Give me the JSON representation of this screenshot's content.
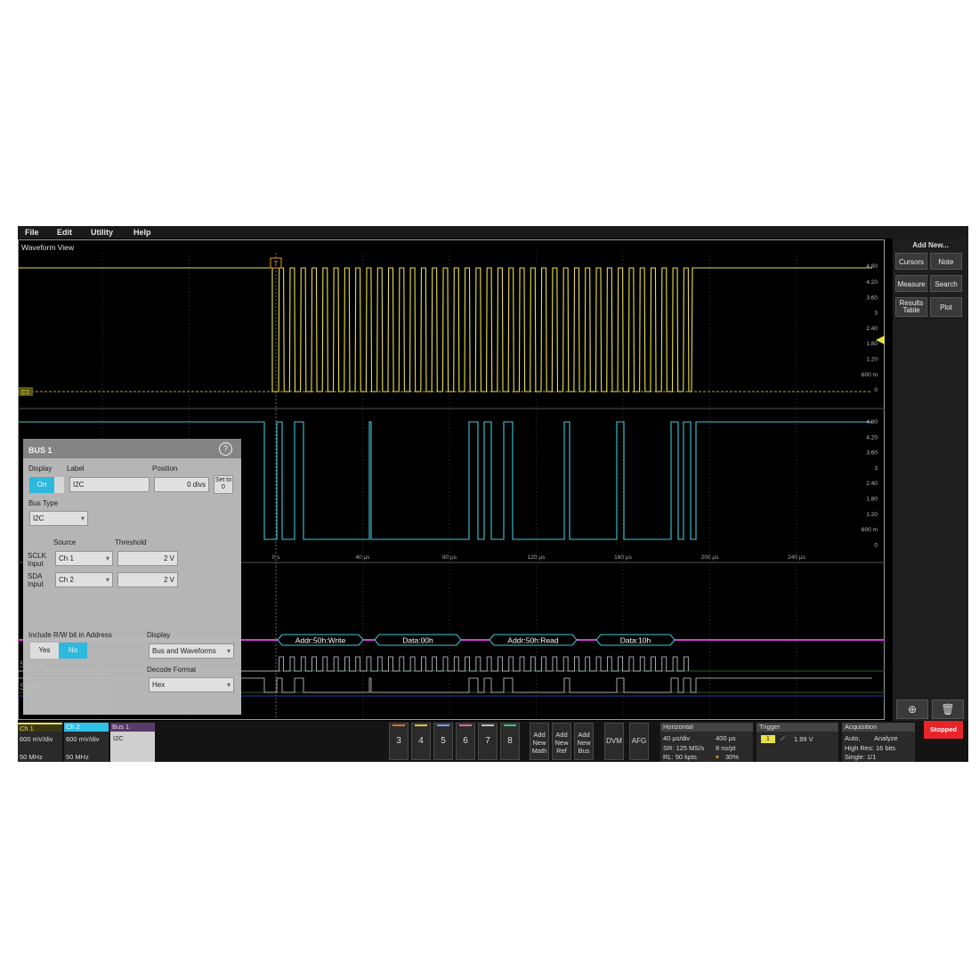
{
  "menu": [
    "File",
    "Edit",
    "Utility",
    "Help"
  ],
  "waveform_view": {
    "title": "Waveform View"
  },
  "side_panel": {
    "title": "Add New...",
    "buttons": [
      [
        "Cursors",
        "Note"
      ],
      [
        "Measure",
        "Search"
      ],
      [
        "Results Table",
        "Plot"
      ]
    ]
  },
  "ch1_scale": [
    "4.20",
    "3.60",
    "3",
    "2.40",
    "1.80",
    "1.20",
    "600 m",
    "0"
  ],
  "ch2_scale": [
    "4.80",
    "4.20",
    "3.60",
    "3",
    "2.40",
    "1.80",
    "1.20",
    "600 m",
    "0"
  ],
  "ch1_top": "4.80",
  "ch1_marker": "C1",
  "time_axis": [
    "0 s",
    "40 µs",
    "80 µs",
    "120 µs",
    "160 µs",
    "200 µs",
    "240 µs"
  ],
  "decode": [
    "Addr:50h:Write",
    "Data:00h",
    "Addr:50h:Read",
    "Data:10h"
  ],
  "bus_labels": {
    "sclk": "SCLK",
    "sda": "SDA"
  },
  "bus_panel": {
    "title": "BUS 1",
    "help": "?",
    "display_label": "Display",
    "display_on": "On",
    "label_label": "Label",
    "label_value": "I2C",
    "position_label": "Position",
    "position_value": "0 divs",
    "set_to_zero": "Set to 0",
    "bus_type_label": "Bus Type",
    "bus_type_value": "I2C",
    "source_label": "Source",
    "threshold_label": "Threshold",
    "sclk_input": "SCLK Input",
    "sda_input": "SDA Input",
    "sclk_source": "Ch 1",
    "sda_source": "Ch 2",
    "sclk_threshold": "2 V",
    "sda_threshold": "2 V",
    "rw_label": "Include R/W bit in Address",
    "rw_yes": "Yes",
    "rw_no": "No",
    "display2_label": "Display",
    "display2_value": "Bus and Waveforms",
    "decode_format_label": "Decode Format",
    "decode_format_value": "Hex"
  },
  "bottom": {
    "ch1": {
      "name": "Ch 1",
      "scale": "600 mV/div",
      "bw": "50 MHz"
    },
    "ch2": {
      "name": "Ch 2",
      "scale": "600 mV/div",
      "bw": "50 MHz"
    },
    "bus1": {
      "name": "Bus 1",
      "type": "I2C"
    },
    "numbers": [
      "3",
      "4",
      "5",
      "6",
      "7",
      "8"
    ],
    "add_buttons": [
      [
        "Add",
        "New",
        "Math"
      ],
      [
        "Add",
        "New",
        "Ref"
      ],
      [
        "Add",
        "New",
        "Bus"
      ]
    ],
    "dvm": "DVM",
    "afg": "AFG",
    "horizontal": {
      "title": "Horizontal",
      "scale": "40 µs/div",
      "duration": "400 µs",
      "sr": "SR: 125 MS/s",
      "res": "8 ns/pt",
      "rl": "RL: 50 kpts",
      "pos": "30%"
    },
    "trigger": {
      "title": "Trigger",
      "source": "1",
      "level": "1.99 V"
    },
    "acquisition": {
      "title": "Acquisition",
      "mode": "Auto,",
      "mode2": "Analyze",
      "res": "High Res: 16 bits",
      "single": "Single: 1/1"
    },
    "stopped": "Stopped"
  },
  "colors": {
    "ch1": "#e8e04a",
    "ch2": "#3fc9d6",
    "bus": "#d040d0",
    "accent": "#2fc0e8",
    "stopped": "#e8242a"
  }
}
